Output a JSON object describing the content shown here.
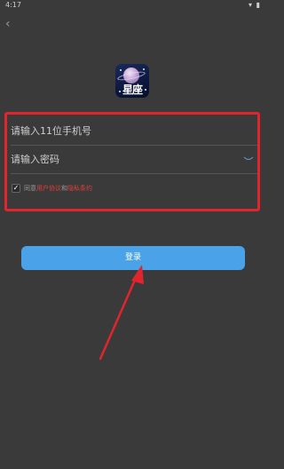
{
  "status_bar": {
    "time": "4:17",
    "icons": "▾ ▮"
  },
  "back": {
    "icon": "chevron-left-icon",
    "glyph": "‹"
  },
  "logo": {
    "text": "星座"
  },
  "form": {
    "phone_placeholder": "请输入11位手机号",
    "password_placeholder": "请输入密码",
    "agree": {
      "checked": true,
      "check_glyph": "✓",
      "prefix": "同意",
      "user_agreement": "用户协议",
      "conjunction": "和",
      "privacy_policy": "隐私条约"
    }
  },
  "login_button": {
    "label": "登录"
  },
  "colors": {
    "background": "#3a3a3a",
    "highlight": "#e0252c",
    "button": "#4aa3e8",
    "link": "#e0403a"
  }
}
